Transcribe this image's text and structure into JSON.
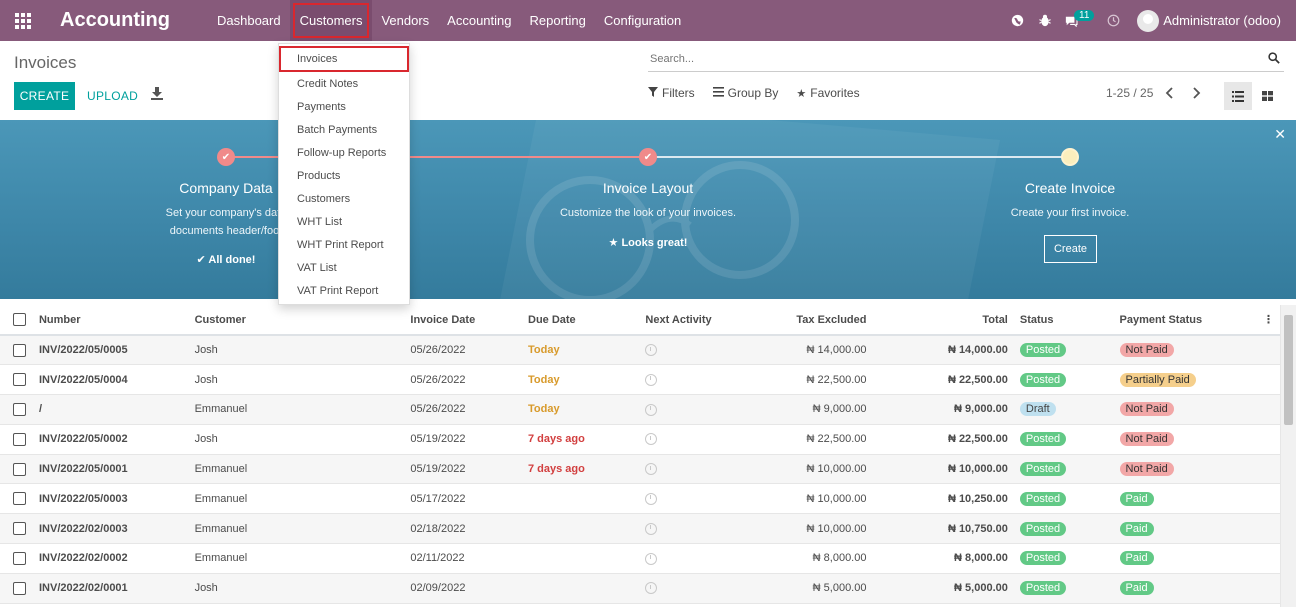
{
  "navbar": {
    "brand": "Accounting",
    "menus": [
      "Dashboard",
      "Customers",
      "Vendors",
      "Accounting",
      "Reporting",
      "Configuration"
    ],
    "active_menu": "Customers",
    "messages_count": "11",
    "user_name": "Administrator (odoo)"
  },
  "control_panel": {
    "title": "Invoices",
    "create_label": "CREATE",
    "upload_label": "UPLOAD",
    "search_placeholder": "Search...",
    "filters_label": "Filters",
    "group_by_label": "Group By",
    "favorites_label": "Favorites",
    "pager": "1-25 / 25"
  },
  "dropdown": {
    "items": [
      "Invoices",
      "Credit Notes",
      "Payments",
      "Batch Payments",
      "Follow-up Reports",
      "Products",
      "Customers",
      "WHT List",
      "WHT Print Report",
      "VAT List",
      "VAT Print Report"
    ],
    "selected": "Invoices"
  },
  "onboarding": {
    "steps": [
      {
        "title": "Company Data",
        "desc1": "Set your company's data",
        "desc2": "documents header/foot",
        "status": "All done!"
      },
      {
        "title": "Invoice Layout",
        "desc1": "Customize the look of your invoices.",
        "status": "Looks great!"
      },
      {
        "title": "Create Invoice",
        "desc1": "Create your first invoice.",
        "button": "Create"
      }
    ]
  },
  "table": {
    "headers": [
      "Number",
      "Customer",
      "Invoice Date",
      "Due Date",
      "Next Activity",
      "Tax Excluded",
      "Total",
      "Status",
      "Payment Status"
    ],
    "rows": [
      {
        "number": "INV/2022/05/0005",
        "customer": "Josh",
        "invoice_date": "05/26/2022",
        "due": "Today",
        "due_type": "today",
        "tax_excluded": "₦ 14,000.00",
        "total": "₦ 14,000.00",
        "status": "Posted",
        "payment": "Not Paid"
      },
      {
        "number": "INV/2022/05/0004",
        "customer": "Josh",
        "invoice_date": "05/26/2022",
        "due": "Today",
        "due_type": "today",
        "tax_excluded": "₦ 22,500.00",
        "total": "₦ 22,500.00",
        "status": "Posted",
        "payment": "Partially Paid"
      },
      {
        "number": "/",
        "customer": "Emmanuel",
        "invoice_date": "05/26/2022",
        "due": "Today",
        "due_type": "today",
        "tax_excluded": "₦ 9,000.00",
        "total": "₦ 9,000.00",
        "status": "Draft",
        "payment": "Not Paid"
      },
      {
        "number": "INV/2022/05/0002",
        "customer": "Josh",
        "invoice_date": "05/19/2022",
        "due": "7 days ago",
        "due_type": "late",
        "tax_excluded": "₦ 22,500.00",
        "total": "₦ 22,500.00",
        "status": "Posted",
        "payment": "Not Paid"
      },
      {
        "number": "INV/2022/05/0001",
        "customer": "Emmanuel",
        "invoice_date": "05/19/2022",
        "due": "7 days ago",
        "due_type": "late",
        "tax_excluded": "₦ 10,000.00",
        "total": "₦ 10,000.00",
        "status": "Posted",
        "payment": "Not Paid"
      },
      {
        "number": "INV/2022/05/0003",
        "customer": "Emmanuel",
        "invoice_date": "05/17/2022",
        "due": "",
        "due_type": "",
        "tax_excluded": "₦ 10,000.00",
        "total": "₦ 10,250.00",
        "status": "Posted",
        "payment": "Paid"
      },
      {
        "number": "INV/2022/02/0003",
        "customer": "Emmanuel",
        "invoice_date": "02/18/2022",
        "due": "",
        "due_type": "",
        "tax_excluded": "₦ 10,000.00",
        "total": "₦ 10,750.00",
        "status": "Posted",
        "payment": "Paid"
      },
      {
        "number": "INV/2022/02/0002",
        "customer": "Emmanuel",
        "invoice_date": "02/11/2022",
        "due": "",
        "due_type": "",
        "tax_excluded": "₦ 8,000.00",
        "total": "₦ 8,000.00",
        "status": "Posted",
        "payment": "Paid"
      },
      {
        "number": "INV/2022/02/0001",
        "customer": "Josh",
        "invoice_date": "02/09/2022",
        "due": "",
        "due_type": "",
        "tax_excluded": "₦ 5,000.00",
        "total": "₦ 5,000.00",
        "status": "Posted",
        "payment": "Paid"
      }
    ]
  },
  "colors": {
    "navbar": "#875a7b",
    "primary": "#00a09d",
    "highlight": "#d9272e"
  }
}
